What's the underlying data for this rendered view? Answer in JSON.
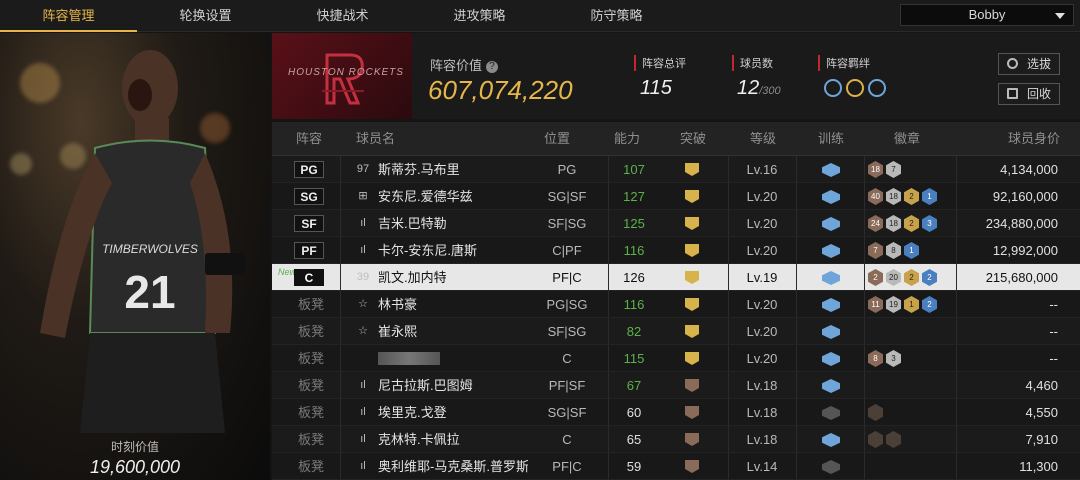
{
  "nav": {
    "tabs": [
      "阵容管理",
      "轮换设置",
      "快捷战术",
      "进攻策略",
      "防守策略"
    ],
    "active": 0,
    "user": "Bobby"
  },
  "portrait": {
    "jersey_team": "TIMBERWOLVES",
    "jersey_number": "21",
    "value_label": "时刻价值",
    "value": "19,600,000"
  },
  "team": {
    "logo_text": "HOUSTON ROCKETS",
    "value_label": "阵容价值",
    "value": "607,074,220",
    "rating_label": "阵容总评",
    "rating": "115",
    "players_label": "球员数",
    "players": "12",
    "players_max": "/300",
    "bond_label": "阵容羁绊",
    "select_btn": "选拔",
    "recycle_btn": "回收"
  },
  "table": {
    "headers": [
      "阵容",
      "球员名",
      "位置",
      "能力",
      "突破",
      "等级",
      "训练",
      "徽章",
      "球员身价"
    ],
    "rows": [
      {
        "slot": "PG",
        "icon": "97",
        "name": "斯蒂芬.马布里",
        "pos": "PG",
        "ability": "107",
        "ab_color": "green",
        "lv": "Lv.16",
        "train": "blue",
        "badges": [
          [
            "18",
            "bronze"
          ],
          [
            "7",
            "silver"
          ]
        ],
        "salary": "4,134,000"
      },
      {
        "slot": "SG",
        "icon": "⊞",
        "name": "安东尼.爱德华兹",
        "pos": "SG|SF",
        "ability": "127",
        "ab_color": "green",
        "lv": "Lv.20",
        "train": "blue",
        "badges": [
          [
            "40",
            "bronze"
          ],
          [
            "18",
            "silver"
          ],
          [
            "2",
            "gold"
          ],
          [
            "1",
            "blue"
          ]
        ],
        "salary": "92,160,000"
      },
      {
        "slot": "SF",
        "icon": "ıl",
        "name": "吉米.巴特勒",
        "pos": "SF|SG",
        "ability": "125",
        "ab_color": "green",
        "lv": "Lv.20",
        "train": "blue",
        "badges": [
          [
            "24",
            "bronze"
          ],
          [
            "18",
            "silver"
          ],
          [
            "2",
            "gold"
          ],
          [
            "3",
            "blue"
          ]
        ],
        "salary": "234,880,000"
      },
      {
        "slot": "PF",
        "icon": "ıl",
        "name": "卡尔-安东尼.唐斯",
        "pos": "C|PF",
        "ability": "116",
        "ab_color": "green",
        "lv": "Lv.20",
        "train": "blue",
        "badges": [
          [
            "7",
            "bronze"
          ],
          [
            "8",
            "silver"
          ],
          [
            "1",
            "blue"
          ]
        ],
        "salary": "12,992,000"
      },
      {
        "slot": "C",
        "icon": "39",
        "name": "凯文.加内特",
        "pos": "PF|C",
        "ability": "126",
        "ab_color": "white",
        "lv": "Lv.19",
        "train": "blue",
        "badges": [
          [
            "2",
            "bronze"
          ],
          [
            "20",
            "silver"
          ],
          [
            "2",
            "gold"
          ],
          [
            "2",
            "blue"
          ]
        ],
        "salary": "215,680,000",
        "selected": true,
        "new": "New"
      },
      {
        "slot": "板凳",
        "icon": "☆",
        "name": "林书豪",
        "pos": "PG|SG",
        "ability": "116",
        "ab_color": "green",
        "lv": "Lv.20",
        "train": "blue",
        "badges": [
          [
            "11",
            "bronze"
          ],
          [
            "19",
            "silver"
          ],
          [
            "1",
            "gold"
          ],
          [
            "2",
            "blue"
          ]
        ],
        "salary": "--"
      },
      {
        "slot": "板凳",
        "icon": "☆",
        "name": "崔永熙",
        "pos": "SF|SG",
        "ability": "82",
        "ab_color": "green",
        "lv": "Lv.20",
        "train": "blue",
        "badges": [],
        "salary": "--"
      },
      {
        "slot": "板凳",
        "icon": "",
        "name": "",
        "pos": "C",
        "ability": "115",
        "ab_color": "green",
        "lv": "Lv.20",
        "train": "blue",
        "badges": [
          [
            "8",
            "bronze"
          ],
          [
            "3",
            "silver"
          ]
        ],
        "salary": "--",
        "blurred": true
      },
      {
        "slot": "板凳",
        "icon": "ıl",
        "name": "尼古拉斯.巴图姆",
        "pos": "PF|SF",
        "ability": "67",
        "ab_color": "green",
        "lv": "Lv.18",
        "train": "blue",
        "badges": [],
        "salary": "4,460",
        "bt": "1"
      },
      {
        "slot": "板凳",
        "icon": "ıl",
        "name": "埃里克.戈登",
        "pos": "SG|SF",
        "ability": "60",
        "ab_color": "white",
        "lv": "Lv.18",
        "train": "dim",
        "badges": [
          [
            "0",
            "dim"
          ]
        ],
        "salary": "4,550",
        "bt": "1"
      },
      {
        "slot": "板凳",
        "icon": "ıl",
        "name": "克林特.卡佩拉",
        "pos": "C",
        "ability": "65",
        "ab_color": "white",
        "lv": "Lv.18",
        "train": "blue",
        "badges": [
          [
            "0",
            "dim"
          ],
          [
            "0",
            "dim"
          ]
        ],
        "salary": "7,910",
        "bt": "1"
      },
      {
        "slot": "板凳",
        "icon": "ıl",
        "name": "奥利维耶-马克桑斯.普罗斯珀",
        "pos": "PF|C",
        "ability": "59",
        "ab_color": "white",
        "lv": "Lv.14",
        "train": "dim",
        "badges": [],
        "salary": "11,300",
        "bt": "1"
      }
    ]
  },
  "colors": {
    "accent": "#e6b64a",
    "green": "#5cb24a",
    "red": "#c0282c",
    "blue": "#6fa5d8"
  }
}
